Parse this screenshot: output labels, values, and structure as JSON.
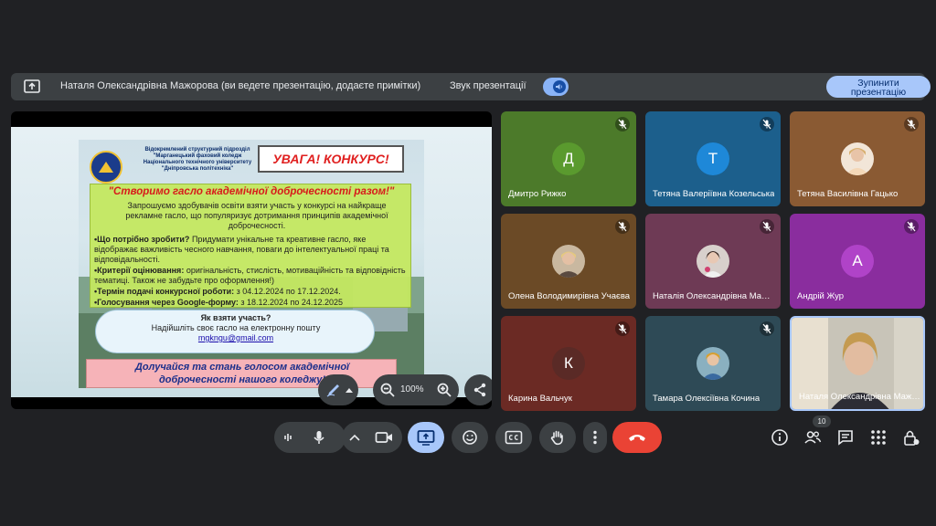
{
  "banner": {
    "presenter_text": "Наталя Олександрівна Мажорова (ви ведете презентацію, додаєте примітки)",
    "sound_label": "Звук презентації",
    "stop_button_line1": "Зупинити",
    "stop_button_line2": "презентацію"
  },
  "slide": {
    "org_line1": "Відокремлений структурний підрозділ",
    "org_line2": "\"Марганецький фаховий коледж",
    "org_line3": "Національного технічного університету",
    "org_line4": "\"Дніпровська політехніка\"",
    "alert": "УВАГА! КОНКУРС!",
    "slogan": "\"Створимо гасло академічної доброчесності разом!\"",
    "intro": "Запрошуємо здобувачів освіти взяти участь у конкурсі на найкраще рекламне гасло, що популяризує дотримання принципів академічної доброчесності.",
    "task_label": "•Що потрібно зробити?",
    "task_text": " Придумати унікальне та креативне гасло, яке відображає важливість чесного навчання, поваги до інтелектуальної праці та відповідальності.",
    "criteria_label": "•Критерії оцінювання:",
    "criteria_text": " оригінальність, стислість, мотиваційність та відповідність тематиці. Також не забудьте про оформлення!)",
    "deadline_label": "•Термін подачі конкурсної роботи:",
    "deadline_text": " з 04.12.2024 по 17.12.2024.",
    "vote_label": "•Голосування через Google-форму:",
    "vote_text": " з 18.12.2024 по 24.12.2025",
    "how_question": "Як взяти участь?",
    "how_hint": "Надійшліть своє гасло на електронну пошту",
    "email": "mgkngu@gmail.com",
    "footer_line1": "Долучайся та стань голосом академічної",
    "footer_line2": "доброчесності нашого коледжу!"
  },
  "share_controls": {
    "zoom": "100%"
  },
  "participants": [
    {
      "name": "Дмитро Рижко",
      "initial": "Д",
      "tile_color": "#4c7a2a",
      "avatar_color": "#5a9a2e"
    },
    {
      "name": "Тетяна Валеріївна Козельська",
      "initial": "Т",
      "tile_color": "#1c5f8c",
      "avatar_color": "#1e88d8"
    },
    {
      "name": "Тетяна Василівна Гацько",
      "initial": "",
      "tile_color": "#8a5a33",
      "avatar_color": ""
    },
    {
      "name": "Олена Володимирівна Учаєва",
      "initial": "",
      "tile_color": "#6b4a26",
      "avatar_color": ""
    },
    {
      "name": "Наталія Олександрівна Мажорова",
      "initial": "",
      "tile_color": "#6e3a55",
      "avatar_color": ""
    },
    {
      "name": "Андрій Жур",
      "initial": "А",
      "tile_color": "#8a2d9e",
      "avatar_color": "#b043c8"
    },
    {
      "name": "Карина Вальчук",
      "initial": "К",
      "tile_color": "#6b2a24",
      "avatar_color": "#5a2a26"
    },
    {
      "name": "Тамара Олексіївна Кочина",
      "initial": "",
      "tile_color": "#2e4a56",
      "avatar_color": ""
    },
    {
      "name": "Наталя Олександрівна Мажорова",
      "initial": "",
      "tile_color": "#3a3a3a",
      "avatar_color": ""
    }
  ],
  "participants_count": "10",
  "colors": {
    "background": "#202124",
    "control": "#3c4043",
    "accent": "#8ab4f8",
    "hangup": "#ea4335"
  }
}
